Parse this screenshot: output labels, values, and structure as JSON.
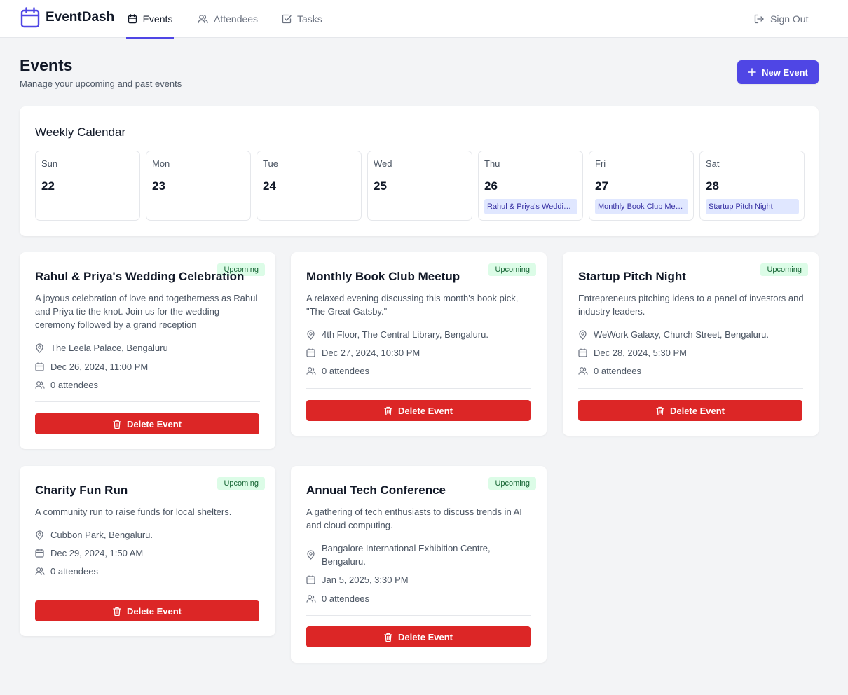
{
  "app": {
    "name": "EventDash"
  },
  "nav": {
    "tabs": [
      {
        "label": "Events",
        "icon": "calendar-icon",
        "active": true
      },
      {
        "label": "Attendees",
        "icon": "users-icon",
        "active": false
      },
      {
        "label": "Tasks",
        "icon": "check-square-icon",
        "active": false
      }
    ],
    "sign_out": "Sign Out"
  },
  "header": {
    "title": "Events",
    "subtitle": "Manage your upcoming and past events",
    "new_event_label": "New Event"
  },
  "calendar": {
    "title": "Weekly Calendar",
    "days": [
      {
        "dow": "Sun",
        "date": "22",
        "event": ""
      },
      {
        "dow": "Mon",
        "date": "23",
        "event": ""
      },
      {
        "dow": "Tue",
        "date": "24",
        "event": ""
      },
      {
        "dow": "Wed",
        "date": "25",
        "event": ""
      },
      {
        "dow": "Thu",
        "date": "26",
        "event": "Rahul & Priya's Wedding Celebration"
      },
      {
        "dow": "Fri",
        "date": "27",
        "event": "Monthly Book Club Meetup"
      },
      {
        "dow": "Sat",
        "date": "28",
        "event": "Startup Pitch Night"
      }
    ]
  },
  "events": [
    {
      "title": "Rahul & Priya's Wedding Celebration",
      "status": "Upcoming",
      "description": "A joyous celebration of love and togetherness as Rahul and Priya tie the knot. Join us for the wedding ceremony followed by a grand reception",
      "location": "The Leela Palace, Bengaluru",
      "datetime": "Dec 26, 2024, 11:00 PM",
      "attendees": "0 attendees",
      "delete_label": "Delete Event"
    },
    {
      "title": "Monthly Book Club Meetup",
      "status": "Upcoming",
      "description": "A relaxed evening discussing this month's book pick, \"The Great Gatsby.\"",
      "location": "4th Floor, The Central Library, Bengaluru.",
      "datetime": "Dec 27, 2024, 10:30 PM",
      "attendees": "0 attendees",
      "delete_label": "Delete Event"
    },
    {
      "title": "Startup Pitch Night",
      "status": "Upcoming",
      "description": "Entrepreneurs pitching ideas to a panel of investors and industry leaders.",
      "location": "WeWork Galaxy, Church Street, Bengaluru.",
      "datetime": "Dec 28, 2024, 5:30 PM",
      "attendees": "0 attendees",
      "delete_label": "Delete Event"
    },
    {
      "title": "Charity Fun Run",
      "status": "Upcoming",
      "description": "A community run to raise funds for local shelters.",
      "location": "Cubbon Park, Bengaluru.",
      "datetime": "Dec 29, 2024, 1:50 AM",
      "attendees": "0 attendees",
      "delete_label": "Delete Event"
    },
    {
      "title": "Annual Tech Conference",
      "status": "Upcoming",
      "description": "A gathering of tech enthusiasts to discuss trends in AI and cloud computing.",
      "location": "Bangalore International Exhibition Centre, Bengaluru.",
      "datetime": "Jan 5, 2025, 3:30 PM",
      "attendees": "0 attendees",
      "delete_label": "Delete Event"
    }
  ],
  "colors": {
    "primary": "#4f46e5",
    "danger": "#dc2626",
    "badge_bg": "#dcfce7",
    "badge_text": "#166534",
    "calendar_event_bg": "#e0e7ff"
  }
}
